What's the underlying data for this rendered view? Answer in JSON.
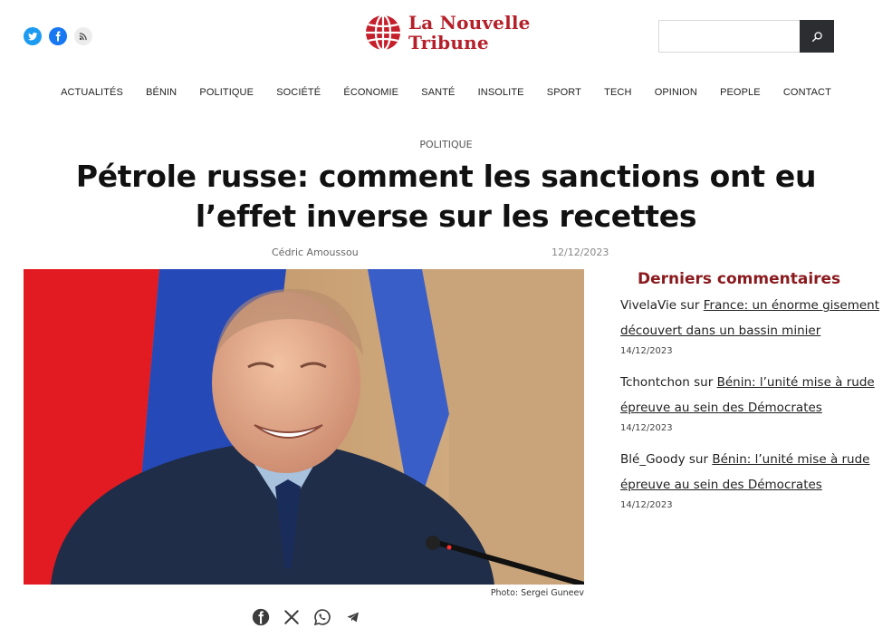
{
  "header": {
    "social": [
      {
        "name": "twitter-icon"
      },
      {
        "name": "facebook-icon"
      },
      {
        "name": "rss-icon"
      }
    ],
    "logo_line1": "La Nouvelle",
    "logo_line2": "Tribune",
    "search_placeholder": "",
    "colors": {
      "brand": "#b5202a",
      "sidebar_title": "#8b1a1e",
      "search_button": "#2b2d30"
    }
  },
  "nav": [
    "ACTUALITÉS",
    "BÉNIN",
    "POLITIQUE",
    "SOCIÉTÉ",
    "ÉCONOMIE",
    "SANTÉ",
    "INSOLITE",
    "SPORT",
    "TECH",
    "OPINION",
    "PEOPLE",
    "CONTACT"
  ],
  "article": {
    "category": "POLITIQUE",
    "title": "Pétrole russe: comment les sanctions ont eu l’effet inverse sur les recettes",
    "author": "Cédric Amoussou",
    "date": "12/12/2023",
    "photo_credit": "Photo: Sergei Guneev",
    "share_icons": [
      "facebook-icon",
      "x-icon",
      "whatsapp-icon",
      "telegram-icon"
    ]
  },
  "sidebar": {
    "title": "Derniers commentaires",
    "comments": [
      {
        "author": "VivelaVie",
        "sep": " sur ",
        "link": "France: un énorme gisement découvert dans un bassin minier",
        "date": "14/12/2023"
      },
      {
        "author": "Tchontchon",
        "sep": " sur ",
        "link": "Bénin: l’unité mise à rude épreuve au sein des Démocrates",
        "date": "14/12/2023"
      },
      {
        "author": "Blé_Goody",
        "sep": " sur ",
        "link": "Bénin: l’unité mise à rude épreuve au sein des Démocrates",
        "date": "14/12/2023"
      }
    ]
  }
}
